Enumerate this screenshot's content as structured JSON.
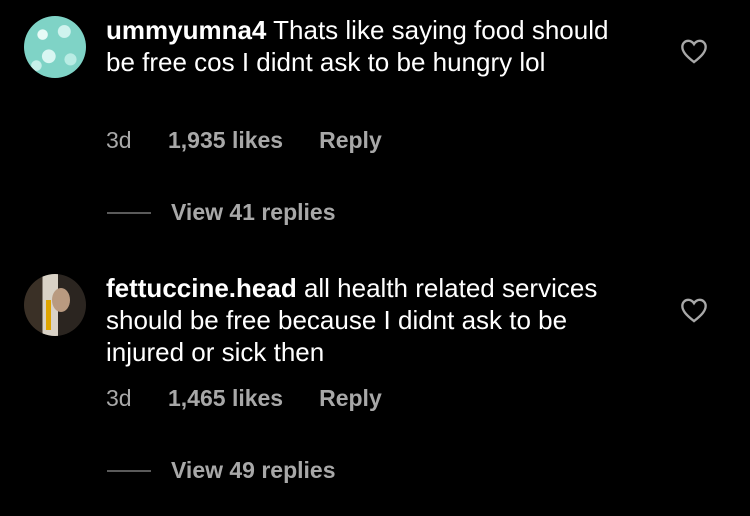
{
  "comments": [
    {
      "username": "ummyumna4",
      "text": " Thats like saying food should be free cos I didnt ask to be hungry lol",
      "time": "3d",
      "likes": "1,935 likes",
      "reply_label": "Reply",
      "view_replies": "View 41 replies"
    },
    {
      "username": "fettuccine.head",
      "text": " all health related services should be free because I didnt ask to be injured or sick then",
      "time": "3d",
      "likes": "1,465 likes",
      "reply_label": "Reply",
      "view_replies": "View 49 replies"
    }
  ],
  "icons": {
    "like": "heart-outline-icon"
  }
}
